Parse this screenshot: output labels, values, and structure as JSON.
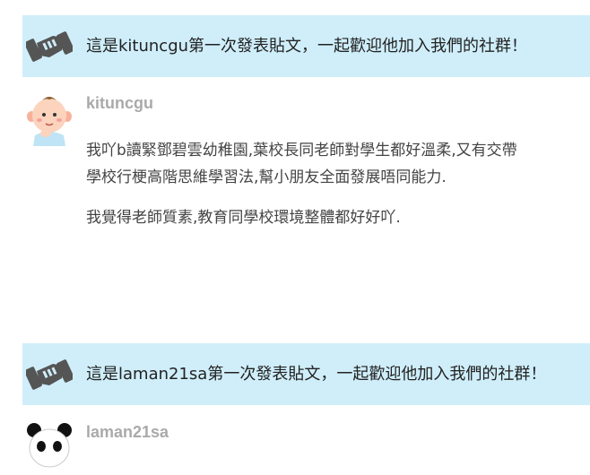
{
  "posts": [
    {
      "welcome_text": "這是kituncgu第一次發表貼文，一起歡迎他加入我們的社群！",
      "username": "kituncgu",
      "body_lines": [
        "我吖b讀緊鄧碧雲幼稚園,葉校長同老師對學生都好溫柔,又有交帶",
        "學校行梗高階思維學習法,幫小朋友全面發展唔同能力.",
        "我覺得老師質素,教育同學校環境整體都好好吖."
      ]
    },
    {
      "welcome_text": "這是laman21sa第一次發表貼文，一起歡迎他加入我們的社群！",
      "username": "laman21sa"
    }
  ],
  "icons": {
    "welcome": "handshake-icon",
    "avatar_1": "baby-avatar",
    "avatar_2": "panda-avatar"
  },
  "colors": {
    "welcome_bg": "#cfeefa",
    "username": "#aaaaaa",
    "icon": "#555555"
  }
}
